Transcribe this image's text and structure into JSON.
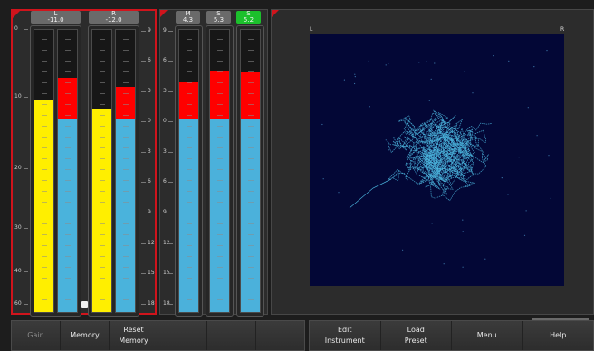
{
  "panels": {
    "lr_meter": {
      "channels": [
        {
          "name": "L",
          "value": "-11.0",
          "peak_level_db": -6.1,
          "fill_level_db": -11.0,
          "fill_color": "#ffef00"
        },
        {
          "name": "R",
          "value": "-12.0",
          "peak_level_db": -7.9,
          "fill_level_db": -12.0,
          "fill_color": "#ffef00"
        }
      ],
      "left_scale": [
        "0",
        "10",
        "20",
        "30",
        "40",
        "60"
      ],
      "right_scale": [
        "9",
        "6",
        "3",
        "0",
        "3",
        "6",
        "9",
        "12",
        "15",
        "18"
      ]
    },
    "ms_meter": {
      "channels": [
        {
          "name": "M",
          "value": "4.3",
          "state": "normal"
        },
        {
          "name": "S",
          "value": "5.3",
          "state": "normal"
        },
        {
          "name": "S",
          "value": "5.2",
          "state": "green"
        }
      ],
      "left_scale": [
        "9",
        "6",
        "3",
        "0",
        "3",
        "6",
        "9",
        "12",
        "15",
        "18"
      ]
    },
    "scope": {
      "left_label": "L",
      "right_label": "R",
      "background": "#030736",
      "trace_color": "#4ab3dc"
    }
  },
  "toolbar_left": [
    "Gain",
    "Memory",
    "Reset\nMemory",
    "",
    "",
    ""
  ],
  "toolbar_left_disabled": [
    true,
    false,
    false,
    false,
    false,
    false
  ],
  "toolbar_right": [
    "Edit\nInstrument",
    "Load\nPreset",
    "Menu",
    "Help"
  ],
  "colors": {
    "accent_red": "#d0141c",
    "meter_red": "#ff0000",
    "meter_yellow": "#ffef00",
    "meter_blue": "#4ab3dc",
    "button_green": "#1cc02c"
  }
}
